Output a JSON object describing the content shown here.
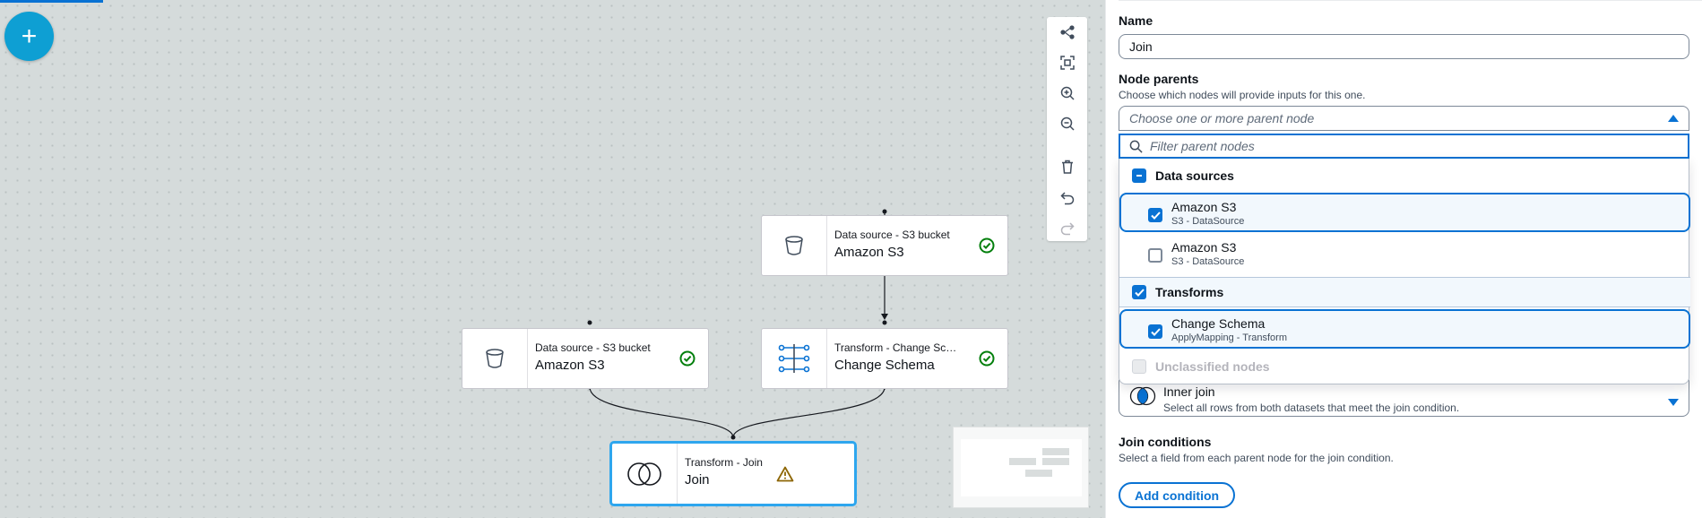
{
  "canvas": {
    "add_button": "+",
    "nodes": [
      {
        "id": "s3_top",
        "type_label": "Data source - S3 bucket",
        "name": "Amazon S3",
        "status": "success",
        "icon": "bucket-icon"
      },
      {
        "id": "s3_left",
        "type_label": "Data source - S3 bucket",
        "name": "Amazon S3",
        "status": "success",
        "icon": "bucket-icon"
      },
      {
        "id": "change_schema",
        "type_label": "Transform - Change Sche...",
        "name": "Change Schema",
        "status": "success",
        "icon": "schema-mapping-icon"
      },
      {
        "id": "join",
        "type_label": "Transform - Join",
        "name": "Join",
        "status": "warning",
        "icon": "join-venn-icon"
      }
    ],
    "toolbar": [
      "layout-icon",
      "fit-view-icon",
      "zoom-in-icon",
      "zoom-out-icon",
      "delete-icon",
      "undo-icon",
      "redo-icon"
    ]
  },
  "panel": {
    "name_label": "Name",
    "name_value": "Join",
    "parents_label": "Node parents",
    "parents_desc": "Choose which nodes will provide inputs for this one.",
    "parents_placeholder": "Choose one or more parent node",
    "filter_placeholder": "Filter parent nodes",
    "groups": {
      "data_sources": "Data sources",
      "transforms": "Transforms",
      "unclassified": "Unclassified nodes"
    },
    "options": [
      {
        "title": "Amazon S3",
        "subtitle": "S3 - DataSource",
        "checked": true
      },
      {
        "title": "Amazon S3",
        "subtitle": "S3 - DataSource",
        "checked": false
      },
      {
        "title": "Change Schema",
        "subtitle": "ApplyMapping - Transform",
        "checked": true
      }
    ],
    "join_type_title": "Inner join",
    "join_type_desc": "Select all rows from both datasets that meet the join condition.",
    "join_conditions_label": "Join conditions",
    "join_conditions_desc": "Select a field from each parent node for the join condition.",
    "add_condition": "Add condition"
  },
  "colors": {
    "accent": "#0972d3",
    "success": "#037f0c",
    "warning": "#8d6605",
    "canvas_bg": "#d5dbdb",
    "add_button": "#0e9fd3",
    "selected_node_border": "#2ea6ee"
  }
}
